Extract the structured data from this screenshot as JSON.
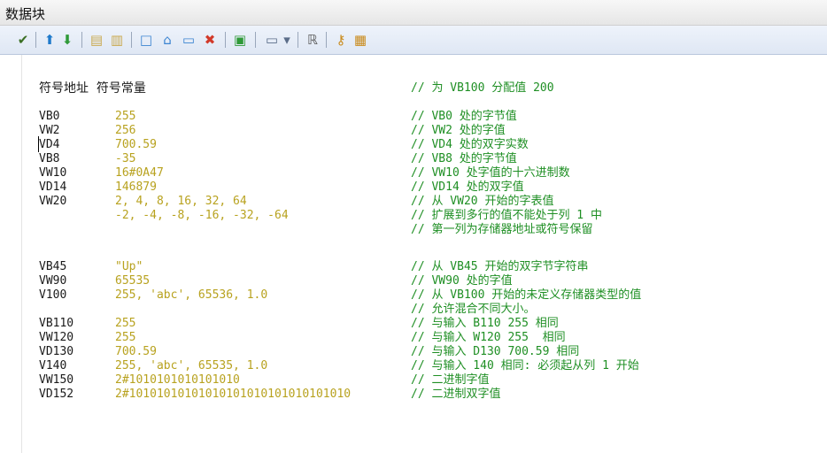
{
  "window": {
    "title": "数据块"
  },
  "toolbar": {
    "icons": [
      {
        "name": "check-icon",
        "glyph": "✔",
        "color": "#3b6f24"
      },
      {
        "name": "arrow-up-icon",
        "glyph": "⬆",
        "color": "#1f7acb"
      },
      {
        "name": "arrow-down-icon",
        "glyph": "⬇",
        "color": "#2f9a38"
      },
      {
        "name": "insert-row-icon",
        "glyph": "▤",
        "color": "#c9a94f"
      },
      {
        "name": "delete-row-icon",
        "glyph": "▥",
        "color": "#c9a94f"
      },
      {
        "name": "blank-box-icon",
        "glyph": "□",
        "color": "#3b84d1"
      },
      {
        "name": "folder-open-icon",
        "glyph": "⌂",
        "color": "#3b84d1"
      },
      {
        "name": "folder-icon",
        "glyph": "▭",
        "color": "#3b84d1"
      },
      {
        "name": "delete-icon",
        "glyph": "✖",
        "color": "#d23a2a"
      },
      {
        "name": "export-icon",
        "glyph": "▣",
        "color": "#2f9a38"
      },
      {
        "name": "window-dropdown-icon",
        "glyph": "▭",
        "color": "#5b6d89"
      },
      {
        "name": "dropdown-arrow-icon",
        "glyph": "▾",
        "color": "#5b6d89"
      },
      {
        "name": "reference-icon",
        "glyph": "ℝ",
        "color": "#5a5a5a"
      },
      {
        "name": "key-icon",
        "glyph": "⚷",
        "color": "#c98a1a"
      },
      {
        "name": "properties-icon",
        "glyph": "▦",
        "color": "#c98a1a"
      }
    ]
  },
  "code": {
    "header": "符号地址  符号常量",
    "header_comment": "// 为 VB100 分配值 200",
    "lines": [
      {
        "addr": "VB0",
        "val": "255",
        "cmt": "// VB0 处的字节值"
      },
      {
        "addr": "VW2",
        "val": "256",
        "cmt": "// VW2 处的字值"
      },
      {
        "addr": "VD4",
        "val": "700.59",
        "cmt": "// VD4 处的双字实数"
      },
      {
        "addr": "VB8",
        "val": "-35",
        "cmt": "// VB8 处的字节值"
      },
      {
        "addr": "VW10",
        "val": "16#0A47",
        "cmt": "// VW10 处字值的十六进制数"
      },
      {
        "addr": "VD14",
        "val": "146879",
        "cmt": "// VD14 处的双字值"
      },
      {
        "addr": "VW20",
        "val": "2, 4, 8, 16, 32, 64",
        "cmt": "// 从 VW20 开始的字表值"
      },
      {
        "addr": "",
        "val": "-2, -4, -8, -16, -32, -64",
        "cmt": "// 扩展到多行的值不能处于列 1 中"
      },
      {
        "addr": "",
        "val": "",
        "cmt": "// 第一列为存储器地址或符号保留"
      },
      {
        "addr": "VB45",
        "val": "\"Up\"",
        "cmt": "// 从 VB45 开始的双字节字符串"
      },
      {
        "addr": "VW90",
        "val": "65535",
        "cmt": "// VW90 处的字值"
      },
      {
        "addr": "V100",
        "val": "255, 'abc', 65536, 1.0",
        "cmt": "// 从 VB100 开始的未定义存储器类型的值"
      },
      {
        "addr": "",
        "val": "",
        "cmt": "// 允许混合不同大小。"
      },
      {
        "addr": "VB110",
        "val": "255",
        "cmt": "// 与输入 B110 255 相同"
      },
      {
        "addr": "VW120",
        "val": "255",
        "cmt": "// 与输入 W120 255  相同"
      },
      {
        "addr": "VD130",
        "val": "700.59",
        "cmt": "// 与输入 D130 700.59 相同"
      },
      {
        "addr": "V140",
        "val": "255, 'abc', 65535, 1.0",
        "cmt": "// 与输入 140 相同: 必须起从列 1 开始"
      },
      {
        "addr": "VW150",
        "val": "2#1010101010101010",
        "cmt": "// 二进制字值"
      },
      {
        "addr": "VD152",
        "val": "2#10101010101010101010101010101010",
        "cmt": "// 二进制双字值"
      }
    ]
  }
}
